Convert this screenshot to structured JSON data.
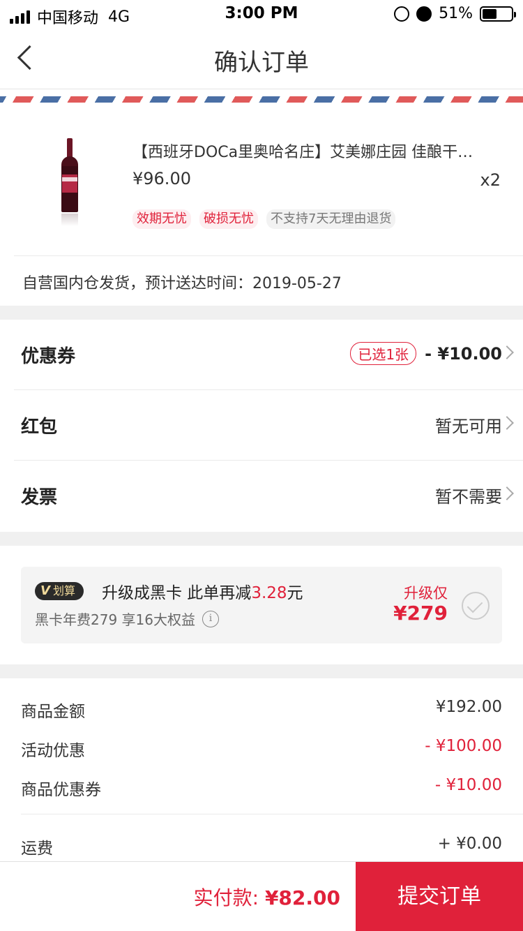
{
  "status_bar": {
    "carrier": "中国移动",
    "network": "4G",
    "time": "3:00 PM",
    "battery": "51%",
    "battery_level": 0.51
  },
  "nav": {
    "title": "确认订单"
  },
  "product": {
    "title": "【西班牙DOCa里奥哈名庄】艾美娜庄园 佳酿干…",
    "price": "¥96.00",
    "quantity": "x2",
    "tags": [
      "效期无忧",
      "破损无忧",
      "不支持7天无理由退货"
    ]
  },
  "shipping": {
    "text": "自营国内仓发货，预计送达时间：2019-05-27"
  },
  "options": {
    "coupon": {
      "label": "优惠券",
      "badge": "已选1张",
      "value": "- ¥10.00"
    },
    "red_packet": {
      "label": "红包",
      "value": "暂无可用"
    },
    "invoice": {
      "label": "发票",
      "value": "暂不需要"
    }
  },
  "upgrade": {
    "badge": "划算",
    "text_prefix": "升级成黑卡 此单再减",
    "amount": "3.28",
    "text_suffix": "元",
    "sub": "黑卡年费279 享16大权益",
    "price_label": "升级仅",
    "price": "¥279"
  },
  "summary": {
    "rows": [
      {
        "label": "商品金额",
        "value": "¥192.00"
      },
      {
        "label": "活动优惠",
        "value": "- ¥100.00"
      },
      {
        "label": "商品优惠券",
        "value": "- ¥10.00"
      },
      {
        "label": "运费",
        "value": "+ ¥0.00"
      }
    ]
  },
  "footer": {
    "pay_label": "实付款:",
    "pay_amount": "¥82.00",
    "submit": "提交订单"
  },
  "colors": {
    "accent": "#e0213a",
    "background": "#f0f0f0"
  }
}
